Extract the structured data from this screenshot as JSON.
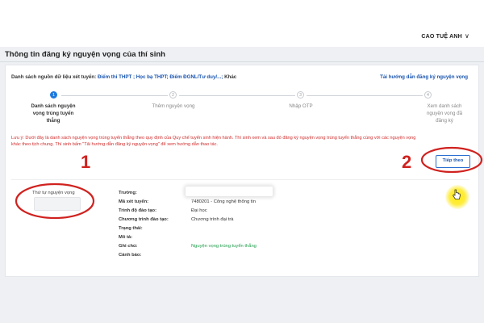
{
  "user": {
    "name": "CAO TUỆ ANH",
    "chevron": "∨"
  },
  "page": {
    "title": "Thông tin đăng ký nguyện vọng của thí sinh"
  },
  "sources": {
    "prefix": "Danh sách nguồn dữ liệu xét tuyển:",
    "items": "Điểm thi THPT ; Học bạ THPT; Điểm ĐGNL/Tư duy/...;",
    "suffix": "Khác"
  },
  "guide_link": "Tải hướng dẫn đăng ký nguyện vọng",
  "steps": [
    {
      "number": "1",
      "label_lines": [
        "Danh sách nguyện",
        "vọng trúng tuyển",
        "thẳng"
      ]
    },
    {
      "number": "2",
      "label_lines": [
        "Thêm nguyện vọng"
      ]
    },
    {
      "number": "3",
      "label_lines": [
        "Nhập OTP"
      ]
    },
    {
      "number": "4",
      "label_lines": [
        "Xem danh sách",
        "nguyện vọng đã",
        "đăng ký"
      ]
    }
  ],
  "notice": {
    "line1": "Lưu ý: Dưới đây là danh sách nguyện vọng trúng tuyển thẳng theo quy định của Quy chế tuyển sinh hiện hành. Thí sinh xem và sau đó đăng ký nguyện vọng trúng tuyển thẳng cùng với các nguyện vọng",
    "line2": "khác theo tịch chung. Thí sinh bấm \"Tải hướng dẫn đăng ký nguyện vọng\" để xem hướng dẫn thao tác."
  },
  "next_button": "Tiếp theo",
  "order": {
    "label": "Thứ tự nguyện vọng",
    "value": ""
  },
  "fields": [
    {
      "label": "Trường:",
      "value": ""
    },
    {
      "label": "Mã xét tuyển:",
      "value": "7480201 - Công nghệ thông tin"
    },
    {
      "label": "Trình độ đào tạo:",
      "value": "Đại học"
    },
    {
      "label": "Chương trình đào tạo:",
      "value": "Chương trình đại trà"
    },
    {
      "label": "Trạng thái:",
      "value": ""
    },
    {
      "label": "Mô tả:",
      "value": ""
    },
    {
      "label": "Ghi chú:",
      "value": "Nguyện vọng trúng tuyển thẳng"
    },
    {
      "label": "Cảnh báo:",
      "value": ""
    }
  ],
  "annotations": {
    "one": "1",
    "two": "2"
  },
  "colors": {
    "accent": "#1f7ae0",
    "link": "#1a55b0",
    "warning": "#d12b2b",
    "success": "#1f9d4a",
    "annotation": "#d0221f"
  }
}
